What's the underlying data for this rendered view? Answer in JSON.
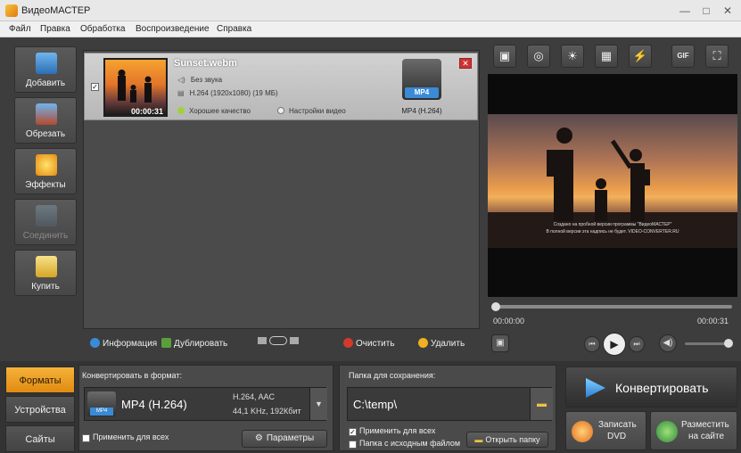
{
  "window": {
    "title": "ВидеоМАСТЕР",
    "minimize": "—",
    "maximize": "□",
    "close": "✕"
  },
  "menu": [
    "Файл",
    "Правка",
    "Обработка",
    "Воспроизведение",
    "Справка"
  ],
  "left_tools": [
    {
      "label": "Добавить",
      "icon": "add-video-icon",
      "enabled": true
    },
    {
      "label": "Обрезать",
      "icon": "cut-video-icon",
      "enabled": true
    },
    {
      "label": "Эффекты",
      "icon": "effects-icon",
      "enabled": true
    },
    {
      "label": "Соединить",
      "icon": "join-icon",
      "enabled": false
    },
    {
      "label": "Купить",
      "icon": "buy-icon",
      "enabled": true
    }
  ],
  "file": {
    "name": "Sunset.webm",
    "duration": "00:00:31",
    "audio": "Без звука",
    "video": "H.264 (1920x1080) (19 МБ)",
    "quality": "Хорошее качество",
    "settings": "Настройки видео",
    "format_tag": "MP4",
    "format_label": "MP4 (H.264)",
    "checked": "✓"
  },
  "list_actions": {
    "info": "Информация",
    "duplicate": "Дублировать",
    "clear": "Очистить",
    "delete": "Удалить"
  },
  "preview": {
    "caption_line1": "Создано на пробной версии программы \"ВидеоМАСТЕР\"",
    "caption_line2": "В полной версии эта надпись не будет. VIDEO-CONVERTER.RU",
    "time_current": "00:00:00",
    "time_total": "00:00:31",
    "progress": 0
  },
  "tabs": [
    "Форматы",
    "Устройства",
    "Сайты"
  ],
  "format_panel": {
    "title": "Конвертировать в формат:",
    "format": "MP4 (H.264)",
    "codec": "H.264, AAC",
    "audio": "44,1 KHz, 192Кбит",
    "apply_all": "Применить для всех",
    "params": "Параметры",
    "tag": "MP4"
  },
  "save_panel": {
    "title": "Папка для сохранения:",
    "path": "C:\\temp\\",
    "apply_all": "Применить для всех",
    "source_folder": "Папка с исходным файлом",
    "open_folder": "Открыть папку",
    "apply_all_checked": "✓"
  },
  "actions": {
    "convert": "Конвертировать",
    "burn_dvd_1": "Записать",
    "burn_dvd_2": "DVD",
    "publish_1": "Разместить",
    "publish_2": "на сайте"
  },
  "colors": {
    "accent_orange": "#f0a030",
    "convert_blue": "#3a8ad6"
  }
}
